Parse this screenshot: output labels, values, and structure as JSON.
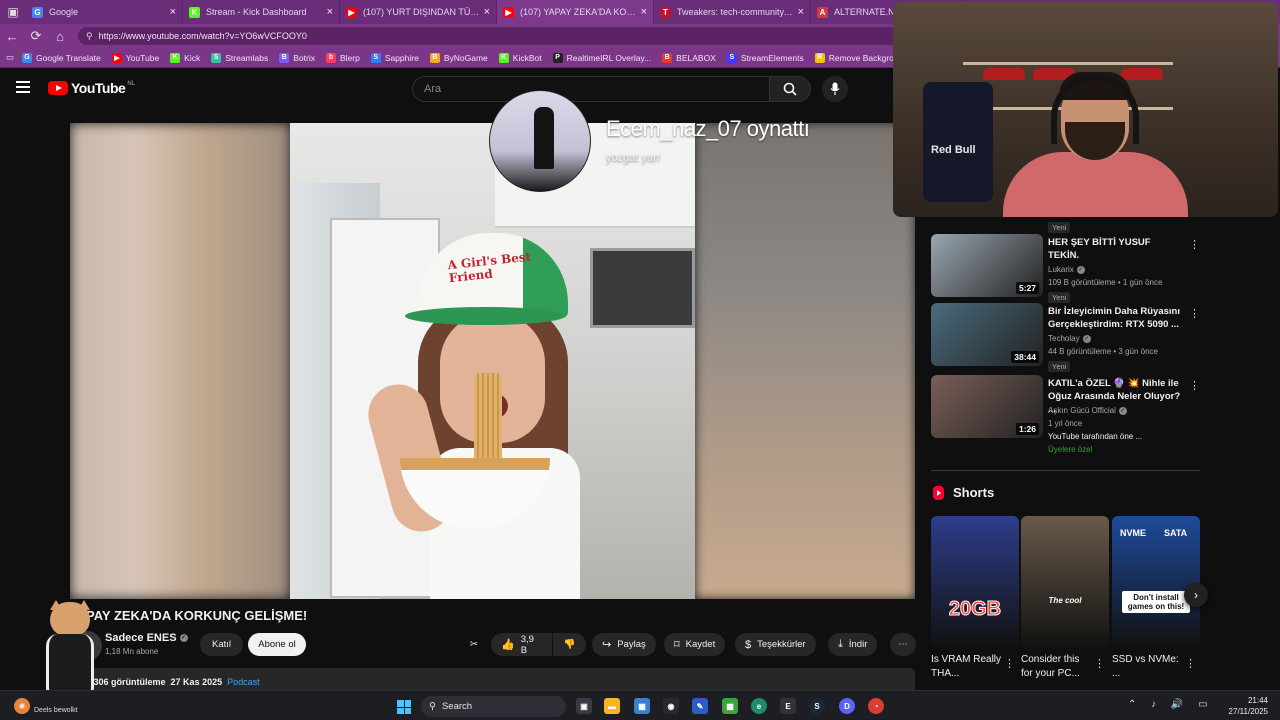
{
  "browser": {
    "tabs": [
      {
        "label": "Google",
        "fav_color": "#4285f4",
        "fav_glyph": "G",
        "active": false
      },
      {
        "label": "Stream - Kick Dashboard",
        "fav_color": "#53fc18",
        "fav_glyph": "K",
        "active": false
      },
      {
        "label": "(107) YURT DIŞINDAN TÜRKİYE'YE",
        "fav_color": "#ff0000",
        "fav_glyph": "▶",
        "active": false
      },
      {
        "label": "(107) YAPAY ZEKA'DA KORKUNÇ",
        "fav_color": "#ff0000",
        "fav_glyph": "▶",
        "active": true
      },
      {
        "label": "Tweakers: tech-community, nieuw",
        "fav_color": "#c8102e",
        "fav_glyph": "T",
        "active": false
      },
      {
        "label": "ALTERNATE.NL",
        "fav_color": "#d8363f",
        "fav_glyph": "A",
        "active": false
      }
    ],
    "url": "https://www.youtube.com/watch?v=YO6wVCFOOY0",
    "bookmarks": [
      {
        "label": "Google Translate",
        "color": "#4285f4",
        "glyph": "G"
      },
      {
        "label": "YouTube",
        "color": "#ff0000",
        "glyph": "▶"
      },
      {
        "label": "Kick",
        "color": "#53fc18",
        "glyph": "K"
      },
      {
        "label": "Streamlabs",
        "color": "#31c3a2",
        "glyph": "S"
      },
      {
        "label": "Botrix",
        "color": "#7a5cff",
        "glyph": "B"
      },
      {
        "label": "Blerp",
        "color": "#ff3d5a",
        "glyph": "b"
      },
      {
        "label": "Sapphire",
        "color": "#2a7fff",
        "glyph": "S"
      },
      {
        "label": "ByNoGame",
        "color": "#f5a623",
        "glyph": "B"
      },
      {
        "label": "KickBot",
        "color": "#53fc18",
        "glyph": "K"
      },
      {
        "label": "RealtimeIRL Overlay...",
        "color": "#222222",
        "glyph": "P"
      },
      {
        "label": "BELABOX",
        "color": "#e53935",
        "glyph": "B"
      },
      {
        "label": "StreamElements",
        "color": "#3b3bff",
        "glyph": "S"
      },
      {
        "label": "Remove Backgroun...",
        "color": "#f5c400",
        "glyph": "R"
      }
    ]
  },
  "youtube": {
    "logo_text": "YouTube",
    "region": "NL",
    "search_placeholder": "Ara"
  },
  "player": {
    "overlay_name": "Ecem_naz_07 oynattı",
    "overlay_sub": "yozgat yarr",
    "cap_text": "A Girl's Best Friend"
  },
  "video": {
    "title": "PAY ZEKA'DA KORKUNÇ GELİŞME!",
    "channel": "Sadece ENES",
    "subscribers": "1,18 Mn abone",
    "join_label": "Katıl",
    "subscribe_label": "Abone ol",
    "likes": "3,9 B",
    "share_label": "Paylaş",
    "save_label": "Kaydet",
    "thanks_label": "Teşekkürler",
    "download_label": "İndir",
    "views": "3.306 görüntüleme",
    "date": "27 Kas 2025",
    "tag": "Podcast"
  },
  "related": [
    {
      "title": "",
      "channel": "",
      "meta": "",
      "badge": "Yeni",
      "duration": "",
      "thumb": "#c5c0b8"
    },
    {
      "title": "HER ŞEY BİTTİ YUSUF TEKİN.",
      "channel": "Lukarix",
      "meta": "109 B görüntüleme • 1 gün önce",
      "badge": "Yeni",
      "duration": "5:27",
      "thumb": "#9aa6b2"
    },
    {
      "title": "Bir İzleyicimin Daha Rüyasını Gerçekleştirdim: RTX 5090 ...",
      "channel": "Techolay",
      "meta": "44 B görüntüleme • 3 gün önce",
      "badge": "Yeni",
      "duration": "38:44",
      "thumb": "#4a6b7d"
    },
    {
      "title": "KATIL'a ÖZEL 🔮 💥 Nihle ile Oğuz Arasında Neler Oluyor? ...",
      "channel": "Aşkın Gücü Official",
      "meta": "1 yıl önce",
      "badge": "",
      "duration": "1:26",
      "thumb": "#7a5e58",
      "extra": "YouTube tarafından öne ...",
      "members": "Üyelere özel"
    }
  ],
  "shorts": {
    "heading": "Shorts",
    "items": [
      {
        "caption": "Is VRAM Really THA...",
        "color": "#2d3e8a",
        "label": "20GB"
      },
      {
        "caption": "Consider this for your PC...",
        "color": "#6a5a4a",
        "label": "The cool"
      },
      {
        "caption": "SSD vs NVMe: ...",
        "color": "#1f4b9a",
        "label": "Don't install games on this!",
        "tags": [
          "NVME",
          "SATA"
        ]
      }
    ]
  },
  "webcam": {
    "jersey_text": "Red Bull"
  },
  "taskbar": {
    "weather": "Deels bewolkt",
    "search": "Search",
    "time": "21:44",
    "date": "27/11/2025"
  }
}
